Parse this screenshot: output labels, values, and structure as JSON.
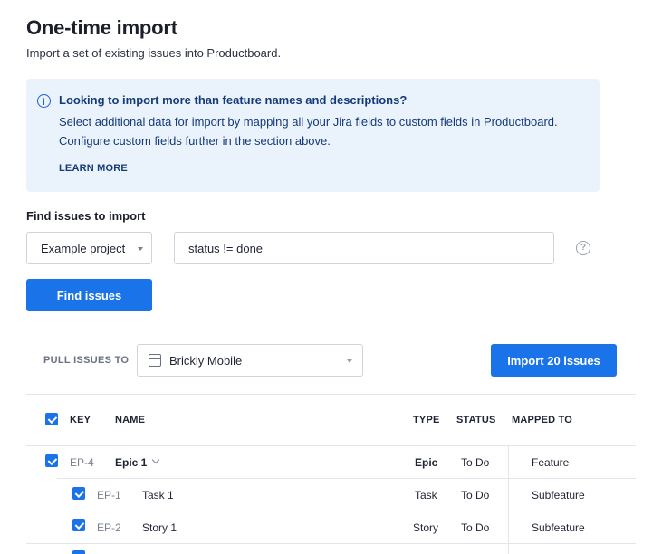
{
  "page": {
    "title": "One-time import",
    "subtitle": "Import a set of existing issues into Productboard."
  },
  "info": {
    "heading": "Looking to import more than feature names and descriptions?",
    "body": "Select additional data for import by mapping all your Jira fields to custom fields in Productboard. Configure custom fields further in the section above.",
    "link": "LEARN MORE",
    "icon": "info-icon"
  },
  "find": {
    "label": "Find issues to import",
    "project": "Example project",
    "query": "status != done",
    "button": "Find issues",
    "help": "?"
  },
  "pull": {
    "label": "PULL ISSUES TO",
    "board": "Brickly Mobile",
    "import_button": "Import 20 issues"
  },
  "table": {
    "headers": {
      "key": "KEY",
      "name": "NAME",
      "type": "TYPE",
      "status": "STATUS",
      "mapped": "MAPPED TO"
    },
    "rows": [
      {
        "key": "EP-4",
        "name": "Epic 1",
        "type": "Epic",
        "status": "To Do",
        "mapped": "Feature"
      },
      {
        "key": "EP-1",
        "name": "Task 1",
        "type": "Task",
        "status": "To Do",
        "mapped": "Subfeature"
      },
      {
        "key": "EP-2",
        "name": "Story 1",
        "type": "Story",
        "status": "To Do",
        "mapped": "Subfeature"
      }
    ]
  },
  "colors": {
    "accent": "#1a73e8",
    "info_bg": "#eaf3fc",
    "info_text": "#153a7a"
  }
}
